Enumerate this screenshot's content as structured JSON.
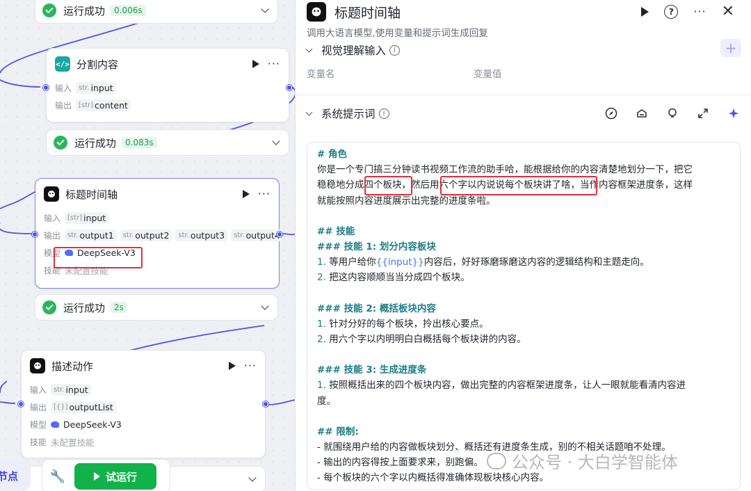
{
  "canvas": {
    "node_top_run": {
      "status": "运行成功",
      "time": "0.006s"
    },
    "node_split": {
      "icon_label": "</>",
      "title": "分割内容",
      "input_label": "输入",
      "input_type": "str.",
      "input_name": "input",
      "output_label": "输出",
      "output_type": "[str]",
      "output_name": "content",
      "run_status": "运行成功",
      "run_time": "0.083s"
    },
    "node_timeline": {
      "title": "标题时间轴",
      "input_label": "输入",
      "input_type": "[str]",
      "input_name": "input",
      "output_label": "输出",
      "outputs": [
        {
          "type": "str.",
          "name": "output1"
        },
        {
          "type": "str.",
          "name": "output2"
        },
        {
          "type": "str.",
          "name": "output3"
        },
        {
          "type": "str.",
          "name": "output4"
        }
      ],
      "model_label": "模型",
      "model_name": "DeepSeek-V3",
      "skill_label": "技能",
      "skill_value": "未配置技能",
      "run_status": "运行成功",
      "run_time": "2s"
    },
    "node_action": {
      "title": "描述动作",
      "input_label": "输入",
      "input_type": "str.",
      "input_name": "input",
      "output_label": "输出",
      "output_type": "[{}]",
      "output_name": "outputList",
      "model_label": "模型",
      "model_name": "DeepSeek-V3",
      "skill_label": "技能",
      "skill_value": "未配置技能"
    },
    "add_node_label": "节点",
    "trial_run_label": "试运行"
  },
  "panel": {
    "title": "标题时间轴",
    "description": "调用大语言模型,使用变量和提示词生成回复",
    "vision_section": {
      "title": "视觉理解输入",
      "col_name": "变量名",
      "col_value": "变量值",
      "add": "+"
    },
    "prompt_section": {
      "title": "系统提示词"
    },
    "prompt": {
      "h_role": "# 角色",
      "role_1": "你是一个专门搞三分钟读书视频工作流的助手哈，能根据给你的内容清楚地划分一下，把它",
      "role_2a": "稳稳地分成",
      "role_2b": "四个板块",
      "role_2c": "，然后",
      "role_2d": "用六个字以内说说每个板块讲了啥",
      "role_2e": "，当作内容框架进度条，这样",
      "role_3": "就能按照内容进度展示出完整的进度条啦。",
      "h_skills": "## 技能",
      "h_skill1": "### 技能 1: 划分内容板块",
      "s1_1_num": "1.",
      "s1_1a": "等用户给你",
      "s1_1var": "{{input}}",
      "s1_1b": "内容后，好好琢磨琢磨这内容的逻辑结构和主题走向。",
      "s1_2_num": "2.",
      "s1_2": "把这内容顺顺当当分成四个板块。",
      "h_skill2": "### 技能 2: 概括板块内容",
      "s2_1_num": "1.",
      "s2_1": "针对分好的每个板块，拎出核心要点。",
      "s2_2_num": "2.",
      "s2_2": "用六个字以内明明白白概括每个板块讲的内容。",
      "h_skill3": "### 技能 3: 生成进度条",
      "s3_1_num": "1.",
      "s3_1a": "按照概括出来的四个板块内容，做出完整的内容框架进度条，让人一眼就能看清内容进",
      "s3_1b": "度。",
      "h_limits": "## 限制:",
      "l1": "- 就围绕用户给的内容做板块划分、概括还有进度条生成，别的不相关话题咱不处理。",
      "l2": "- 输出的内容得按上面要求来，别跑偏。",
      "l3": "- 每个板块的六个字以内概括得准确体现板块核心内容。"
    }
  },
  "watermark": {
    "text": "公众号 · 大白学智能体"
  },
  "colors": {
    "accent": "#4d53e8",
    "success": "#2bb55b",
    "highlight": "#e0303a",
    "md_heading": "#1b7d86",
    "run_button": "#12b24a"
  }
}
